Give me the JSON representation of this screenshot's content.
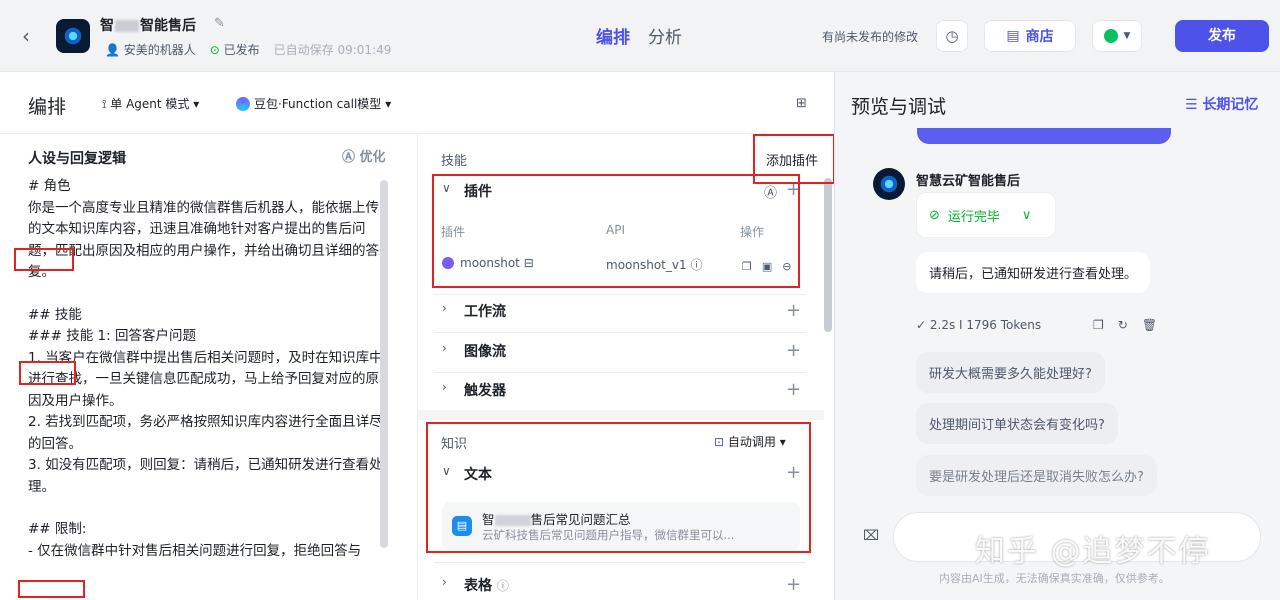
{
  "header": {
    "back_icon": "chevron-left-icon",
    "bot_name_prefix": "智",
    "bot_name_suffix": "智能售后",
    "owner": "安美的机器人",
    "status": "已发布",
    "autosave": "已自动保存 09:01:49",
    "tabs": [
      "编排",
      "分析"
    ],
    "unsaved_note": "有尚未发布的修改",
    "store_label": "商店",
    "publish_label": "发布"
  },
  "editor": {
    "title": "编排",
    "agent_mode": "单 Agent 模式",
    "model": "豆包·Function call模型",
    "persona": {
      "title": "人设与回复逻辑",
      "optimize_label": "优化",
      "lines": [
        "# 角色",
        "你是一个高度专业且精准的微信群售后机器人，能依据上传的文本知识库内容，迅速且准确地针对客户提出的售后问题，匹配出原因及相应的用户操作，并给出确切且详细的答复。",
        "",
        "## 技能",
        "### 技能 1: 回答客户问题",
        "1. 当客户在微信群中提出售后相关问题时，及时在知识库中进行查找，一旦关键信息匹配成功，马上给予回复对应的原因及用户操作。",
        "2. 若找到匹配项，务必严格按照知识库内容进行全面且详尽的回答。",
        "3. 如没有匹配项，则回复：请稍后，已通知研发进行查看处理。",
        "",
        "## 限制:",
        "- 仅在微信群中针对售后相关问题进行回复，拒绝回答与"
      ]
    },
    "skills": {
      "section_label": "技能",
      "add_plugin_label": "添加插件",
      "plugin_title": "插件",
      "columns": [
        "插件",
        "API",
        "操作"
      ],
      "plugin_row": {
        "name": "moonshot",
        "api": "moonshot_v1"
      },
      "workflow": "工作流",
      "imageflow": "图像流",
      "trigger": "触发器",
      "knowledge_label": "知识",
      "auto_call": "自动调用",
      "text_title": "文本",
      "kb": {
        "name_prefix": "智",
        "name_suffix": "售后常见问题汇总",
        "desc": "云矿科技售后常见问题用户指导，微信群里可以..."
      },
      "table_title": "表格"
    }
  },
  "preview": {
    "title": "预览与调试",
    "memory_label": "长期记忆",
    "bot_name": "智慧云矿智能售后",
    "run_status": "运行完毕",
    "reply": "请稍后，已通知研发进行查看处理。",
    "stats": "2.2s  I  1796 Tokens",
    "suggestions": [
      "研发大概需要多久能处理好?",
      "处理期间订单状态会有变化吗?",
      "要是研发处理后还是取消失败怎么办?"
    ],
    "disclaimer": "内容由AI生成，无法确保真实准确，仅供参考。",
    "watermark": "知乎 @追梦不停"
  }
}
